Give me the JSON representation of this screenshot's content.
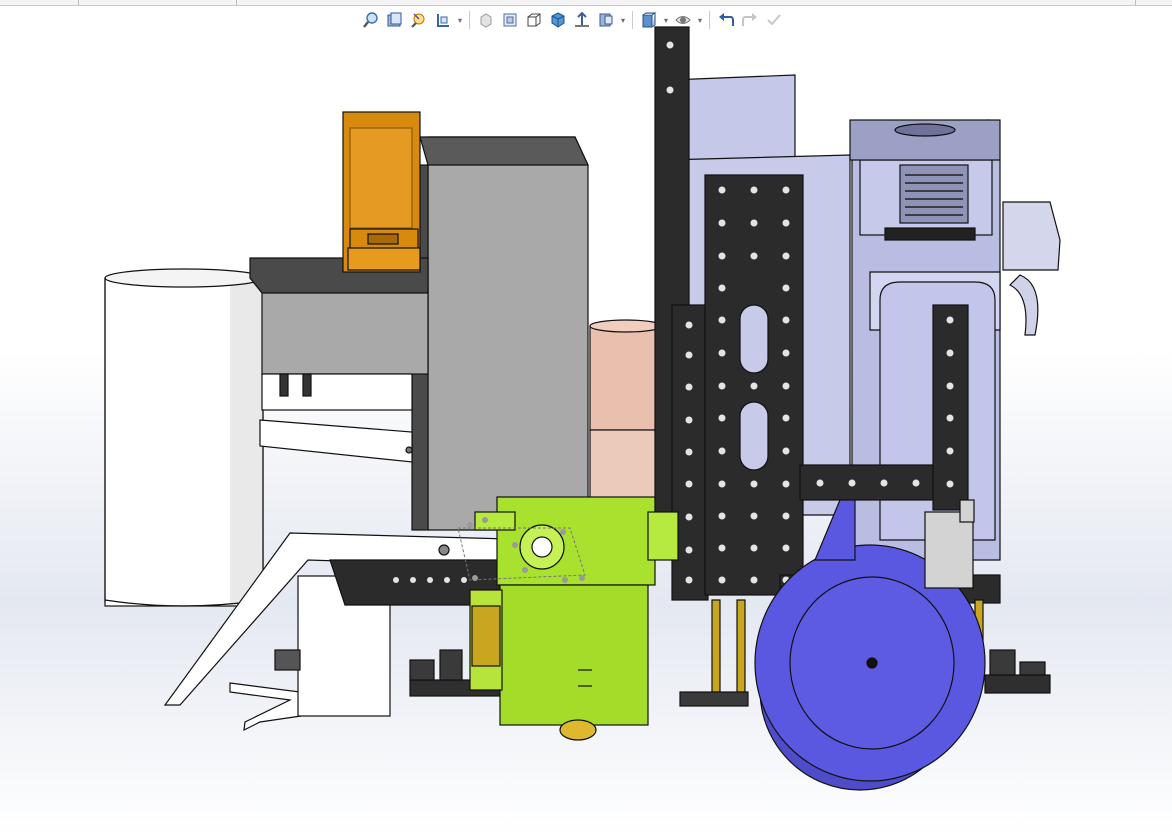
{
  "window": {
    "title": ""
  },
  "toolbar": {
    "items": [
      {
        "icon": "zoom-to-fit-icon",
        "has_dropdown": false
      },
      {
        "icon": "zoom-to-area-icon",
        "has_dropdown": false
      },
      {
        "icon": "previous-view-icon",
        "has_dropdown": false
      },
      {
        "icon": "section-view-icon",
        "has_dropdown": true
      },
      {
        "icon": "view-orientation-icon",
        "has_dropdown": false
      },
      {
        "icon": "display-style-icon",
        "has_dropdown": false
      },
      {
        "icon": "hidden-lines-icon",
        "has_dropdown": false
      },
      {
        "icon": "shaded-with-edges-icon",
        "has_dropdown": false
      },
      {
        "icon": "apply-scene-icon",
        "has_dropdown": false
      },
      {
        "icon": "view-settings-icon",
        "has_dropdown": true
      },
      {
        "icon": "box-display-icon",
        "has_dropdown": true
      },
      {
        "icon": "hide-show-items-icon",
        "has_dropdown": true
      },
      {
        "icon": "undo-icon",
        "has_dropdown": false
      },
      {
        "icon": "redo-icon",
        "has_dropdown": false
      },
      {
        "icon": "confirm-check-icon",
        "has_dropdown": false
      }
    ]
  },
  "model": {
    "description_label": "",
    "colors": {
      "accent_yellow_green": "#a8e22e",
      "wheel_blue": "#5a58e0",
      "sensor_orange": "#d88a0e",
      "frame_gray": "#a9a9a9",
      "plate_black": "#2b2b2b",
      "chassis_lavender": "#c4c7e8",
      "cylinder_pink": "#e9bfae"
    }
  }
}
